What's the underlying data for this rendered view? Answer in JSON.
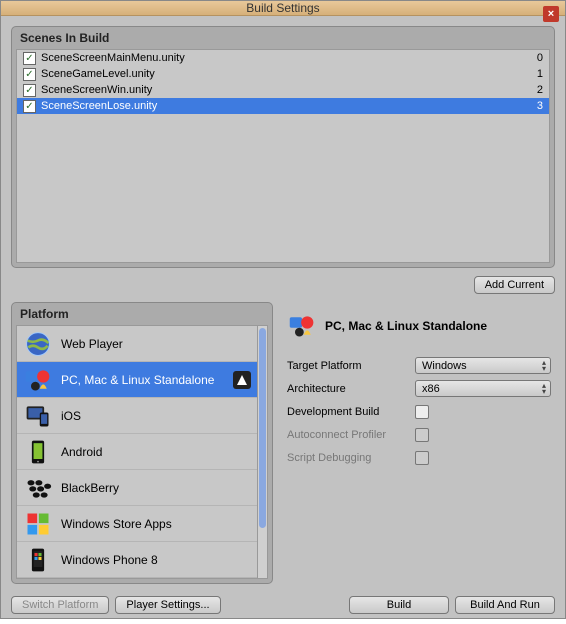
{
  "window": {
    "title": "Build Settings"
  },
  "scenes": {
    "header": "Scenes In Build",
    "items": [
      {
        "name": "SceneScreenMainMenu.unity",
        "index": "0",
        "checked": true,
        "selected": false
      },
      {
        "name": "SceneGameLevel.unity",
        "index": "1",
        "checked": true,
        "selected": false
      },
      {
        "name": "SceneScreenWin.unity",
        "index": "2",
        "checked": true,
        "selected": false
      },
      {
        "name": "SceneScreenLose.unity",
        "index": "3",
        "checked": true,
        "selected": true
      }
    ],
    "add_current": "Add Current"
  },
  "platforms": {
    "header": "Platform",
    "items": [
      {
        "label": "Web Player",
        "icon": "globe",
        "selected": false
      },
      {
        "label": "PC, Mac & Linux Standalone",
        "icon": "pcmaclinux",
        "selected": true
      },
      {
        "label": "iOS",
        "icon": "ios",
        "selected": false
      },
      {
        "label": "Android",
        "icon": "android",
        "selected": false
      },
      {
        "label": "BlackBerry",
        "icon": "blackberry",
        "selected": false
      },
      {
        "label": "Windows Store Apps",
        "icon": "winstore",
        "selected": false
      },
      {
        "label": "Windows Phone 8",
        "icon": "winphone",
        "selected": false
      }
    ]
  },
  "settings": {
    "title": "PC, Mac & Linux Standalone",
    "target_platform": {
      "label": "Target Platform",
      "value": "Windows"
    },
    "architecture": {
      "label": "Architecture",
      "value": "x86"
    },
    "dev_build": {
      "label": "Development Build",
      "checked": false
    },
    "autoconnect": {
      "label": "Autoconnect Profiler",
      "checked": false,
      "disabled": true
    },
    "script_debug": {
      "label": "Script Debugging",
      "checked": false,
      "disabled": true
    }
  },
  "buttons": {
    "switch_platform": "Switch Platform",
    "player_settings": "Player Settings...",
    "build": "Build",
    "build_and_run": "Build And Run"
  }
}
